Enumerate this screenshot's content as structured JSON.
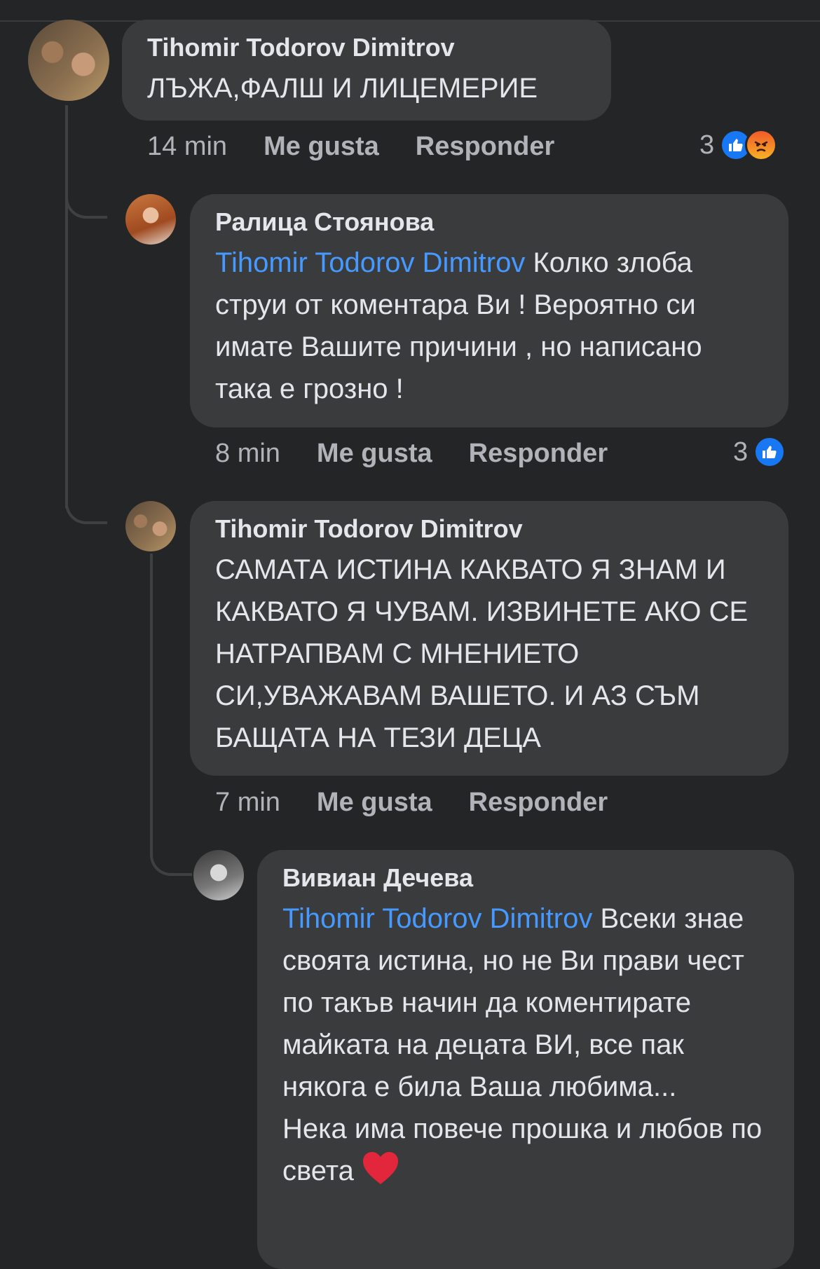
{
  "colors": {
    "background": "#242526",
    "bubble": "#3a3b3c",
    "mention": "#4599ff",
    "like": "#1877f2"
  },
  "comments": [
    {
      "author": "Tihomir Todorov Dimitrov",
      "text": "ЛЪЖА,ФАЛШ И ЛИЦЕМЕРИЕ",
      "time": "14 min",
      "like_label": "Me gusta",
      "reply_label": "Responder",
      "reaction_count": "3"
    },
    {
      "author": "Ралица Стоянова",
      "mention": "Tihomir Todorov Dimitrov",
      "text": " Колко злоба струи от коментара Ви ! Вероятно си имате Вашите причини , но написано така е грозно !",
      "time": "8 min",
      "like_label": "Me gusta",
      "reply_label": "Responder",
      "reaction_count": "3"
    },
    {
      "author": "Tihomir Todorov Dimitrov",
      "text": "САМАТА ИСТИНА КАКВАТО Я ЗНАМ И КАКВАТО Я ЧУВАМ. ИЗВИНЕТЕ АКО СЕ НАТРАПВАМ С МНЕНИЕТО СИ,УВАЖАВАМ ВАШЕТО. И АЗ СЪМ БАЩАТА НА ТЕЗИ ДЕЦА",
      "time": "7 min",
      "like_label": "Me gusta",
      "reply_label": "Responder"
    },
    {
      "author": "Вивиан Дечева",
      "mention": "Tihomir Todorov Dimitrov",
      "text": " Всеки знае своята истина, но не Ви прави чест по такъв начин да коментирате майката на децата ВИ, все пак някога е била Ваша любима...",
      "text2": "Нека има повече прошка и любов по света",
      "emoji": "❤️"
    }
  ]
}
